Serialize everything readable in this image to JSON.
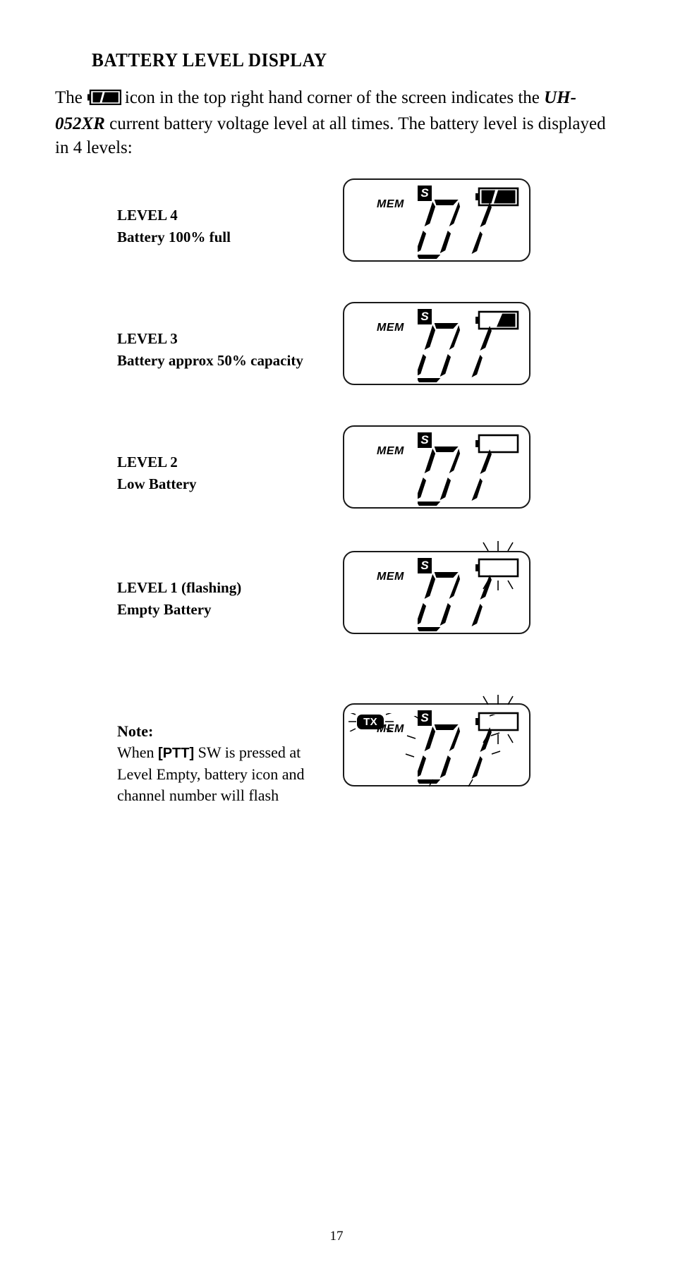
{
  "page": {
    "number": "17",
    "heading": "BATTERY LEVEL DISPLAY"
  },
  "intro": {
    "before_icon": "The",
    "icon_name": "battery-full-icon",
    "after_icon": "icon in the top right hand corner of the screen indicates the",
    "model": "UH-052XR",
    "rest": "current battery voltage level at all times.  The battery level is displayed in 4 levels:"
  },
  "levels": [
    {
      "title": "LEVEL 4",
      "description": "Battery 100% full",
      "lcd": {
        "mem": "MEM",
        "s_badge": "S",
        "tx_badge": null,
        "channel": "01",
        "battery_state": "full",
        "battery_fill_percent": 100,
        "flashing_battery": false,
        "flashing_digits": false
      }
    },
    {
      "title": "LEVEL 3",
      "description": "Battery approx 50% capacity",
      "lcd": {
        "mem": "MEM",
        "s_badge": "S",
        "tx_badge": null,
        "channel": "01",
        "battery_state": "half",
        "battery_fill_percent": 50,
        "flashing_battery": false,
        "flashing_digits": false
      }
    },
    {
      "title": "LEVEL 2",
      "description": "Low Battery",
      "lcd": {
        "mem": "MEM",
        "s_badge": "S",
        "tx_badge": null,
        "channel": "01",
        "battery_state": "low",
        "battery_fill_percent": 0,
        "flashing_battery": false,
        "flashing_digits": false
      }
    },
    {
      "title": "LEVEL 1 (flashing)",
      "description": "Empty Battery",
      "lcd": {
        "mem": "MEM",
        "s_badge": "S",
        "tx_badge": null,
        "channel": "01",
        "battery_state": "empty",
        "battery_fill_percent": 0,
        "flashing_battery": true,
        "flashing_digits": false
      }
    }
  ],
  "note": {
    "title": "Note:",
    "line1_before": "When",
    "ptt": "[PTT]",
    "line1_after": "SW is pressed at Level Empty, battery icon and channel number will flash",
    "lcd": {
      "mem": "MEM",
      "s_badge": "S",
      "tx_badge": "TX",
      "channel": "01",
      "battery_state": "empty",
      "battery_fill_percent": 0,
      "flashing_battery": true,
      "flashing_digits": true,
      "flashing_tx": true
    }
  },
  "colors": {
    "ink": "#000000",
    "paper": "#ffffff",
    "lcd_border": "#1a1a1a"
  }
}
